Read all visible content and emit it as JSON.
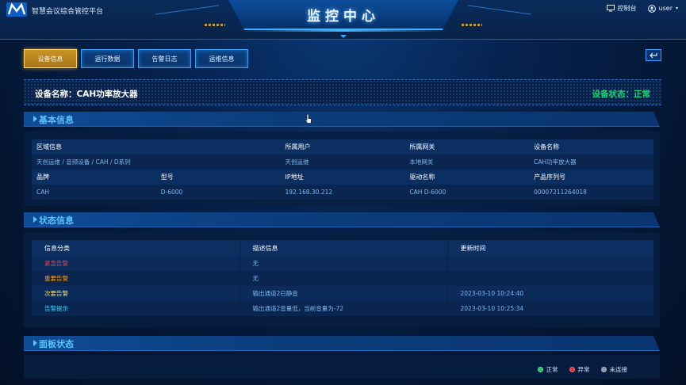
{
  "app": {
    "title": "智慧会议综合管控平台",
    "banner_title": "监控中心",
    "logo_text": "M"
  },
  "topbar": {
    "console_label": "控制台",
    "user_label": "user",
    "console_icon": "monitor-icon",
    "user_icon": "user-circle-icon"
  },
  "tabs": [
    {
      "label": "设备信息",
      "active": true
    },
    {
      "label": "运行数据",
      "active": false
    },
    {
      "label": "告警日志",
      "active": false
    },
    {
      "label": "运维信息",
      "active": false
    }
  ],
  "device": {
    "name_label": "设备名称：CAH功率放大器",
    "status_label": "设备状态：正常",
    "status_color": "#21d27a"
  },
  "sections": {
    "basic": "基本信息",
    "status": "状态信息",
    "panel": "面板状态"
  },
  "basic_info": {
    "row1_headers": [
      "区域信息",
      "所属用户",
      "所属网关",
      "设备名称"
    ],
    "row1_values": [
      "天创运维 / 音频设备 / CAH / D系列",
      "天创运维",
      "本地网关",
      "CAH功率放大器"
    ],
    "row2_headers": [
      "品牌",
      "型号",
      "IP地址",
      "驱动名称",
      "产品序列号"
    ],
    "row2_values": [
      "CAH",
      "D-6000",
      "192.168.30.212",
      "CAH D-6000",
      "00007211264018"
    ]
  },
  "status_info": {
    "headers": [
      "信息分类",
      "描述信息",
      "更新时间"
    ],
    "rows": [
      {
        "category": "紧急告警",
        "color": "#ff3b3b",
        "desc": "无",
        "time": ""
      },
      {
        "category": "重要告警",
        "color": "#f0a020",
        "desc": "无",
        "time": ""
      },
      {
        "category": "次要告警",
        "color": "#ffe14a",
        "desc": "输出通道2已静音",
        "time": "2023-03-10 10:24:40"
      },
      {
        "category": "告警提示",
        "color": "#3fd0f0",
        "desc": "输出通道2音量低，当前音量为-72",
        "time": "2023-03-10 10:25:34"
      }
    ]
  },
  "legend": [
    {
      "label": "正常",
      "color": "#21c46a"
    },
    {
      "label": "异常",
      "color": "#e03030"
    },
    {
      "label": "未连接",
      "color": "#8a93a6"
    }
  ]
}
